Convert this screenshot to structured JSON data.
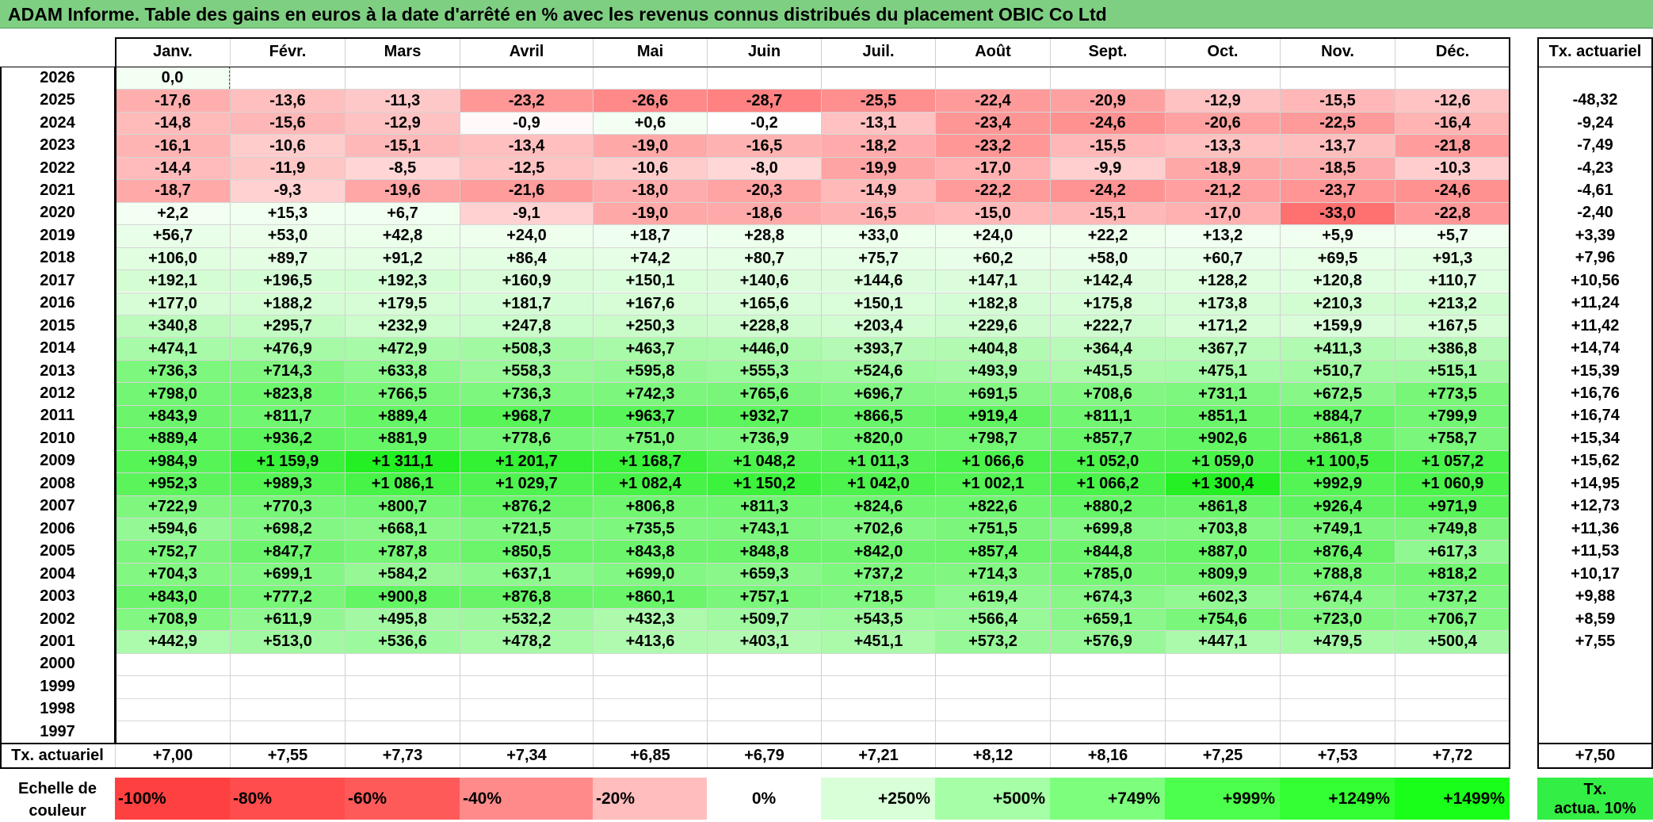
{
  "title": "ADAM Informe. Table des gains en euros à la date d'arrêté en % avec les revenus connus distribués du placement OBIC Co Ltd",
  "months": [
    "Janv.",
    "Févr.",
    "Mars",
    "Avril",
    "Mai",
    "Juin",
    "Juil.",
    "Août",
    "Sept.",
    "Oct.",
    "Nov.",
    "Déc."
  ],
  "rate_header": "Tx. actuariel",
  "rows": [
    {
      "year": "2026",
      "values": [
        "0,0",
        "",
        "",
        "",
        "",
        "",
        "",
        "",
        "",
        "",
        "",
        ""
      ],
      "rate": ""
    },
    {
      "year": "2025",
      "values": [
        "-17,6",
        "-13,6",
        "-11,3",
        "-23,2",
        "-26,6",
        "-28,7",
        "-25,5",
        "-22,4",
        "-20,9",
        "-12,9",
        "-15,5",
        "-12,6"
      ],
      "rate": "-48,32"
    },
    {
      "year": "2024",
      "values": [
        "-14,8",
        "-15,6",
        "-12,9",
        "-0,9",
        "+0,6",
        "-0,2",
        "-13,1",
        "-23,4",
        "-24,6",
        "-20,6",
        "-22,5",
        "-16,4"
      ],
      "rate": "-9,24"
    },
    {
      "year": "2023",
      "values": [
        "-16,1",
        "-10,6",
        "-15,1",
        "-13,4",
        "-19,0",
        "-16,5",
        "-18,2",
        "-23,2",
        "-15,5",
        "-13,3",
        "-13,7",
        "-21,8"
      ],
      "rate": "-7,49"
    },
    {
      "year": "2022",
      "values": [
        "-14,4",
        "-11,9",
        "-8,5",
        "-12,5",
        "-10,6",
        "-8,0",
        "-19,9",
        "-17,0",
        "-9,9",
        "-18,9",
        "-18,5",
        "-10,3"
      ],
      "rate": "-4,23"
    },
    {
      "year": "2021",
      "values": [
        "-18,7",
        "-9,3",
        "-19,6",
        "-21,6",
        "-18,0",
        "-20,3",
        "-14,9",
        "-22,2",
        "-24,2",
        "-21,2",
        "-23,7",
        "-24,6"
      ],
      "rate": "-4,61"
    },
    {
      "year": "2020",
      "values": [
        "+2,2",
        "+15,3",
        "+6,7",
        "-9,1",
        "-19,0",
        "-18,6",
        "-16,5",
        "-15,0",
        "-15,1",
        "-17,0",
        "-33,0",
        "-22,8"
      ],
      "rate": "-2,40"
    },
    {
      "year": "2019",
      "values": [
        "+56,7",
        "+53,0",
        "+42,8",
        "+24,0",
        "+18,7",
        "+28,8",
        "+33,0",
        "+24,0",
        "+22,2",
        "+13,2",
        "+5,9",
        "+5,7"
      ],
      "rate": "+3,39"
    },
    {
      "year": "2018",
      "values": [
        "+106,0",
        "+89,7",
        "+91,2",
        "+86,4",
        "+74,2",
        "+80,7",
        "+75,7",
        "+60,2",
        "+58,0",
        "+60,7",
        "+69,5",
        "+91,3"
      ],
      "rate": "+7,96"
    },
    {
      "year": "2017",
      "values": [
        "+192,1",
        "+196,5",
        "+192,3",
        "+160,9",
        "+150,1",
        "+140,6",
        "+144,6",
        "+147,1",
        "+142,4",
        "+128,2",
        "+120,8",
        "+110,7"
      ],
      "rate": "+10,56"
    },
    {
      "year": "2016",
      "values": [
        "+177,0",
        "+188,2",
        "+179,5",
        "+181,7",
        "+167,6",
        "+165,6",
        "+150,1",
        "+182,8",
        "+175,8",
        "+173,8",
        "+210,3",
        "+213,2"
      ],
      "rate": "+11,24"
    },
    {
      "year": "2015",
      "values": [
        "+340,8",
        "+295,7",
        "+232,9",
        "+247,8",
        "+250,3",
        "+228,8",
        "+203,4",
        "+229,6",
        "+222,7",
        "+171,2",
        "+159,9",
        "+167,5"
      ],
      "rate": "+11,42"
    },
    {
      "year": "2014",
      "values": [
        "+474,1",
        "+476,9",
        "+472,9",
        "+508,3",
        "+463,7",
        "+446,0",
        "+393,7",
        "+404,8",
        "+364,4",
        "+367,7",
        "+411,3",
        "+386,8"
      ],
      "rate": "+14,74"
    },
    {
      "year": "2013",
      "values": [
        "+736,3",
        "+714,3",
        "+633,8",
        "+558,3",
        "+595,8",
        "+555,3",
        "+524,6",
        "+493,9",
        "+451,5",
        "+475,1",
        "+510,7",
        "+515,1"
      ],
      "rate": "+15,39"
    },
    {
      "year": "2012",
      "values": [
        "+798,0",
        "+823,8",
        "+766,5",
        "+736,3",
        "+742,3",
        "+765,6",
        "+696,7",
        "+691,5",
        "+708,6",
        "+731,1",
        "+672,5",
        "+773,5"
      ],
      "rate": "+16,76"
    },
    {
      "year": "2011",
      "values": [
        "+843,9",
        "+811,7",
        "+889,4",
        "+968,7",
        "+963,7",
        "+932,7",
        "+866,5",
        "+919,4",
        "+811,1",
        "+851,1",
        "+884,7",
        "+799,9"
      ],
      "rate": "+16,74"
    },
    {
      "year": "2010",
      "values": [
        "+889,4",
        "+936,2",
        "+881,9",
        "+778,6",
        "+751,0",
        "+736,9",
        "+820,0",
        "+798,7",
        "+857,7",
        "+902,6",
        "+861,8",
        "+758,7"
      ],
      "rate": "+15,34"
    },
    {
      "year": "2009",
      "values": [
        "+984,9",
        "+1 159,9",
        "+1 311,1",
        "+1 201,7",
        "+1 168,7",
        "+1 048,2",
        "+1 011,3",
        "+1 066,6",
        "+1 052,0",
        "+1 059,0",
        "+1 100,5",
        "+1 057,2"
      ],
      "rate": "+15,62"
    },
    {
      "year": "2008",
      "values": [
        "+952,3",
        "+989,3",
        "+1 086,1",
        "+1 029,7",
        "+1 082,4",
        "+1 150,2",
        "+1 042,0",
        "+1 002,1",
        "+1 066,2",
        "+1 300,4",
        "+992,9",
        "+1 060,9"
      ],
      "rate": "+14,95"
    },
    {
      "year": "2007",
      "values": [
        "+722,9",
        "+770,3",
        "+800,7",
        "+876,2",
        "+806,8",
        "+811,3",
        "+824,6",
        "+822,6",
        "+880,2",
        "+861,8",
        "+926,4",
        "+971,9"
      ],
      "rate": "+12,73"
    },
    {
      "year": "2006",
      "values": [
        "+594,6",
        "+698,2",
        "+668,1",
        "+721,5",
        "+735,5",
        "+743,1",
        "+702,6",
        "+751,5",
        "+699,8",
        "+703,8",
        "+749,1",
        "+749,8"
      ],
      "rate": "+11,36"
    },
    {
      "year": "2005",
      "values": [
        "+752,7",
        "+847,7",
        "+787,8",
        "+850,5",
        "+843,8",
        "+848,8",
        "+842,0",
        "+857,4",
        "+844,8",
        "+887,0",
        "+876,4",
        "+617,3"
      ],
      "rate": "+11,53"
    },
    {
      "year": "2004",
      "values": [
        "+704,3",
        "+699,1",
        "+584,2",
        "+637,1",
        "+699,0",
        "+659,3",
        "+737,2",
        "+714,3",
        "+785,0",
        "+809,9",
        "+788,8",
        "+818,2"
      ],
      "rate": "+10,17"
    },
    {
      "year": "2003",
      "values": [
        "+843,0",
        "+777,2",
        "+900,8",
        "+876,8",
        "+860,1",
        "+757,1",
        "+718,5",
        "+619,4",
        "+674,3",
        "+602,3",
        "+674,4",
        "+737,2"
      ],
      "rate": "+9,88"
    },
    {
      "year": "2002",
      "values": [
        "+708,9",
        "+611,9",
        "+495,8",
        "+532,2",
        "+432,3",
        "+509,7",
        "+543,5",
        "+566,4",
        "+659,1",
        "+754,6",
        "+723,0",
        "+706,7"
      ],
      "rate": "+8,59"
    },
    {
      "year": "2001",
      "values": [
        "+442,9",
        "+513,0",
        "+536,6",
        "+478,2",
        "+413,6",
        "+403,1",
        "+451,1",
        "+573,2",
        "+576,9",
        "+447,1",
        "+479,5",
        "+500,4"
      ],
      "rate": "+7,55"
    },
    {
      "year": "2000",
      "values": [
        "",
        "",
        "",
        "",
        "",
        "",
        "",
        "",
        "",
        "",
        "",
        ""
      ],
      "rate": ""
    },
    {
      "year": "1999",
      "values": [
        "",
        "",
        "",
        "",
        "",
        "",
        "",
        "",
        "",
        "",
        "",
        ""
      ],
      "rate": ""
    },
    {
      "year": "1998",
      "values": [
        "",
        "",
        "",
        "",
        "",
        "",
        "",
        "",
        "",
        "",
        "",
        ""
      ],
      "rate": ""
    },
    {
      "year": "1997",
      "values": [
        "",
        "",
        "",
        "",
        "",
        "",
        "",
        "",
        "",
        "",
        "",
        ""
      ],
      "rate": ""
    }
  ],
  "footer": {
    "label": "Tx. actuariel",
    "values": [
      "+7,00",
      "+7,55",
      "+7,73",
      "+7,34",
      "+6,85",
      "+6,79",
      "+7,21",
      "+8,12",
      "+8,16",
      "+7,25",
      "+7,53",
      "+7,72"
    ],
    "overall": "+7,50"
  },
  "scale": {
    "label_line1": "Echelle de",
    "label_line2": "couleur",
    "items": [
      {
        "label": "-100%",
        "color": "#ff4040"
      },
      {
        "label": "-80%",
        "color": "#ff4d4d"
      },
      {
        "label": "-60%",
        "color": "#ff5a5a"
      },
      {
        "label": "-40%",
        "color": "#ff8a8a"
      },
      {
        "label": "-20%",
        "color": "#ffbdbd"
      },
      {
        "label": "0%",
        "color": "#ffffff"
      },
      {
        "label": "+250%",
        "color": "#d8ffd8"
      },
      {
        "label": "+500%",
        "color": "#a6ffa6"
      },
      {
        "label": "+749%",
        "color": "#7dff7d"
      },
      {
        "label": "+999%",
        "color": "#4dff4d"
      },
      {
        "label": "+1249%",
        "color": "#33ff33"
      },
      {
        "label": "+1499%",
        "color": "#1aff1a"
      }
    ],
    "target_line1": "Tx.",
    "target_line2": "actua. 10%",
    "target_color": "#33ee44"
  }
}
